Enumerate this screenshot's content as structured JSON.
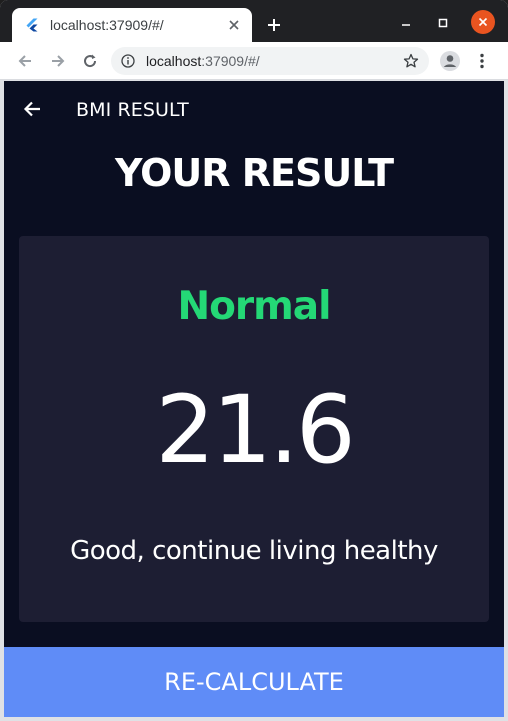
{
  "browser": {
    "tab_title": "localhost:37909/#/",
    "url_host": "localhost",
    "url_rest": ":37909/#/",
    "icons": {
      "favicon": "flutter-icon",
      "tab_close": "close-icon",
      "new_tab": "plus-icon",
      "minimize": "minimize-icon",
      "maximize": "maximize-icon",
      "close_window": "close-icon",
      "back": "arrow-left-icon",
      "forward": "arrow-right-icon",
      "reload": "reload-icon",
      "site_info": "info-icon",
      "bookmark": "star-icon",
      "profile": "avatar-icon",
      "menu": "kebab-menu-icon"
    }
  },
  "app": {
    "title": "BMI RESULT",
    "heading": "YOUR RESULT",
    "result": {
      "status": "Normal",
      "bmi": "21.6",
      "advice": "Good, continue living healthy"
    },
    "button_label": "RE-CALCULATE",
    "colors": {
      "background": "#0a0e21",
      "card": "#1d1e33",
      "status": "#24d876",
      "button": "#5f8cf7"
    }
  }
}
